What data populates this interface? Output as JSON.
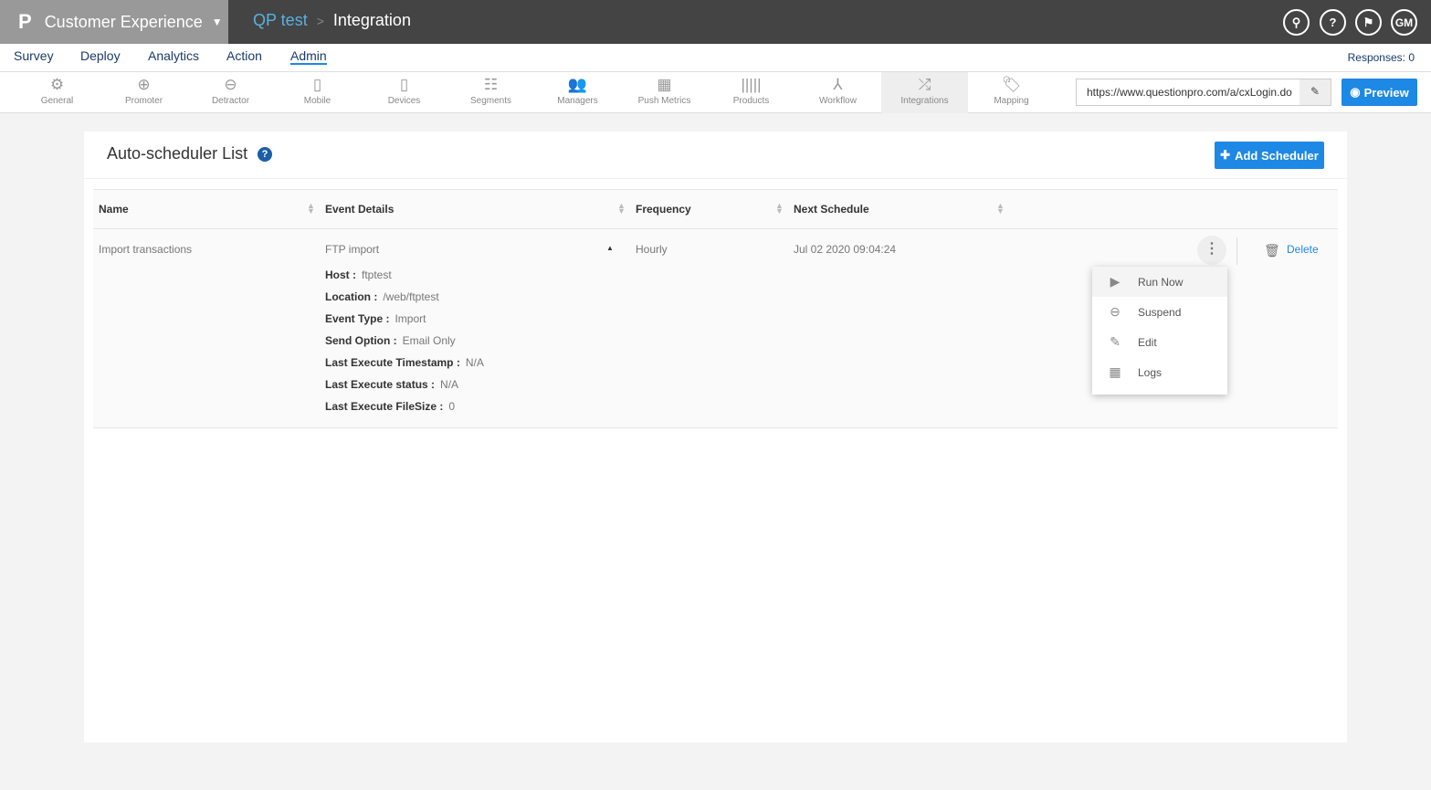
{
  "header": {
    "app_name": "Customer Experience",
    "breadcrumb": [
      "QP test",
      "Integration"
    ],
    "icons": [
      "search-icon",
      "help-icon",
      "bell-icon"
    ],
    "avatar": "GM"
  },
  "nav": {
    "items": [
      "Survey",
      "Deploy",
      "Analytics",
      "Action",
      "Admin"
    ],
    "active": "Admin",
    "responses": "Responses: 0"
  },
  "toolbar": {
    "items": [
      "General",
      "Promoter",
      "Detractor",
      "Mobile",
      "Devices",
      "Segments",
      "Managers",
      "Push Metrics",
      "Products",
      "Workflow",
      "Integrations",
      "Mapping"
    ],
    "active": "Integrations",
    "url": "https://www.questionpro.com/a/cxLogin.do",
    "preview": "Preview"
  },
  "main": {
    "title": "Auto-scheduler List",
    "add_button": "Add Scheduler",
    "columns": [
      "Name",
      "Event Details",
      "Frequency",
      "Next Schedule"
    ],
    "row": {
      "name": "Import transactions",
      "event": "FTP import",
      "frequency": "Hourly",
      "next": "Jul 02 2020 09:04:24",
      "details": [
        {
          "label": "Host :",
          "value": "ftptest"
        },
        {
          "label": "Location :",
          "value": "/web/ftptest"
        },
        {
          "label": "Event Type :",
          "value": "Import"
        },
        {
          "label": "Send Option :",
          "value": "Email Only"
        },
        {
          "label": "Last Execute Timestamp :",
          "value": "N/A"
        },
        {
          "label": "Last Execute status :",
          "value": "N/A"
        },
        {
          "label": "Last Execute FileSize :",
          "value": "0"
        }
      ],
      "delete": "Delete"
    },
    "menu": [
      "Run Now",
      "Suspend",
      "Edit",
      "Logs"
    ]
  },
  "colors": {
    "accent": "#1e88e5",
    "topbar": "#444444"
  }
}
